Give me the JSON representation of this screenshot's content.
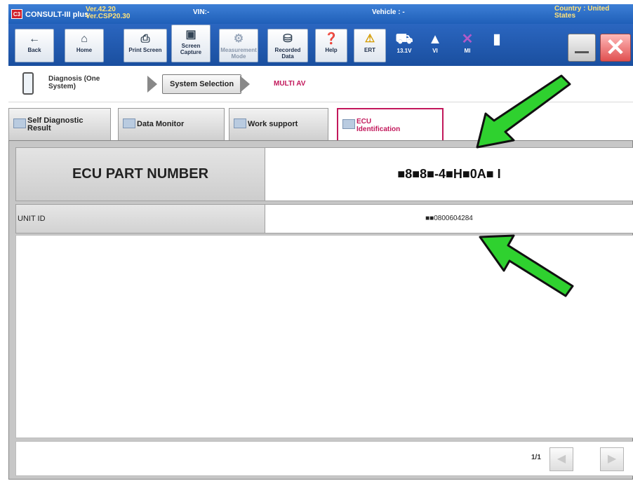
{
  "titlebar": {
    "logo": "C3",
    "app_name": "CONSULT-III plus",
    "version_line1": "Ver.42.20",
    "version_line2": "Ver.CSP20.30",
    "vin": "VIN:-",
    "vehicle": "Vehicle : -",
    "country": "Country : United States"
  },
  "toolbar": {
    "back": "Back",
    "home": "Home",
    "print_screen": "Print Screen",
    "screen_capture": "Screen Capture",
    "measurement_mode": "Measurement Mode",
    "recorded_data": "Recorded Data",
    "help": "Help",
    "ert": "ERT",
    "voltage": "13.1V",
    "vi": "VI",
    "mi": "MI"
  },
  "breadcrumb": {
    "step1": "Diagnosis (One System)",
    "step2": "System Selection",
    "step3": "MULTI AV"
  },
  "tabs": [
    {
      "label": "Self Diagnostic Result"
    },
    {
      "label": "Data Monitor"
    },
    {
      "label": "Work support"
    },
    {
      "label": "ECU Identification"
    }
  ],
  "ecu": {
    "part_number_label": "ECU PART NUMBER",
    "part_number_value": "■8■8■-4■H■0A■ I",
    "unit_id_label": "UNIT ID",
    "unit_id_value": "■■0800604284"
  },
  "pager": {
    "page": "1/1"
  },
  "colors": {
    "title_blue": "#1f5fb8",
    "active_tab": "#c2185b",
    "arrow_green": "#2fd12f"
  }
}
